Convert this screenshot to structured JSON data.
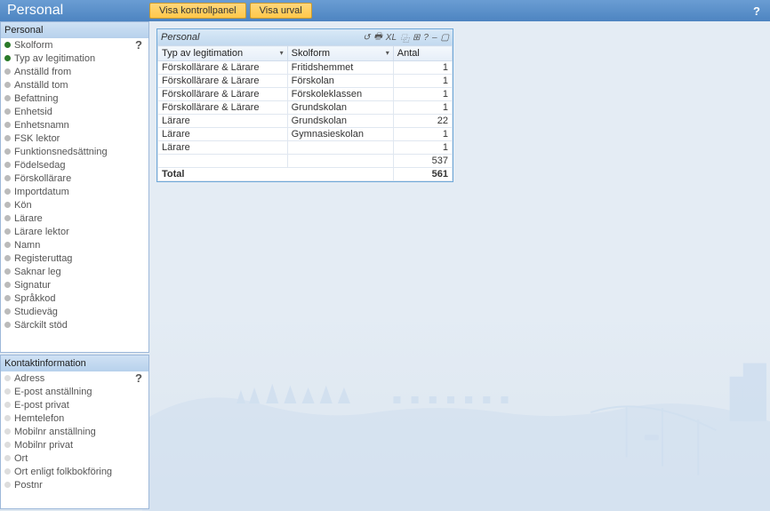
{
  "header": {
    "title": "Personal",
    "btn_panel": "Visa kontrollpanel",
    "btn_urval": "Visa urval",
    "help": "?"
  },
  "sidebar1": {
    "title": "Personal",
    "help": "?",
    "items": [
      {
        "label": "Skolform",
        "on": true
      },
      {
        "label": "Typ av legitimation",
        "on": true
      },
      {
        "label": "Anställd from",
        "on": false
      },
      {
        "label": "Anställd tom",
        "on": false
      },
      {
        "label": "Befattning",
        "on": false
      },
      {
        "label": "Enhetsid",
        "on": false
      },
      {
        "label": "Enhetsnamn",
        "on": false
      },
      {
        "label": "FSK lektor",
        "on": false
      },
      {
        "label": "Funktionsnedsättning",
        "on": false
      },
      {
        "label": "Födelsedag",
        "on": false
      },
      {
        "label": "Förskollärare",
        "on": false
      },
      {
        "label": "Importdatum",
        "on": false
      },
      {
        "label": "Kön",
        "on": false
      },
      {
        "label": "Lärare",
        "on": false
      },
      {
        "label": "Lärare lektor",
        "on": false
      },
      {
        "label": "Namn",
        "on": false
      },
      {
        "label": "Registeruttag",
        "on": false
      },
      {
        "label": "Saknar leg",
        "on": false
      },
      {
        "label": "Signatur",
        "on": false
      },
      {
        "label": "Språkkod",
        "on": false
      },
      {
        "label": "Studieväg",
        "on": false
      },
      {
        "label": "Särckilt stöd",
        "on": false
      }
    ]
  },
  "sidebar2": {
    "title": "Kontaktinformation",
    "help": "?",
    "items": [
      {
        "label": "Adress"
      },
      {
        "label": "E-post anställning"
      },
      {
        "label": "E-post privat"
      },
      {
        "label": "Hemtelefon"
      },
      {
        "label": "Mobilnr anställning"
      },
      {
        "label": "Mobilnr privat"
      },
      {
        "label": "Ort"
      },
      {
        "label": "Ort enligt folkbokföring"
      },
      {
        "label": "Postnr"
      }
    ]
  },
  "table": {
    "title": "Personal",
    "icons": [
      "↺",
      "🖶",
      "XL",
      "⿻",
      "⊞",
      "?",
      "–",
      "▢"
    ],
    "cols": [
      "Typ av legitimation",
      "Skolform",
      "Antal"
    ],
    "rows": [
      {
        "c0": "Förskollärare & Lärare",
        "c1": "Fritidshemmet",
        "c2": "1"
      },
      {
        "c0": "Förskollärare & Lärare",
        "c1": "Förskolan",
        "c2": "1"
      },
      {
        "c0": "Förskollärare & Lärare",
        "c1": "Förskoleklassen",
        "c2": "1"
      },
      {
        "c0": "Förskollärare & Lärare",
        "c1": "Grundskolan",
        "c2": "1"
      },
      {
        "c0": "Lärare",
        "c1": "Grundskolan",
        "c2": "22"
      },
      {
        "c0": "Lärare",
        "c1": "Gymnasieskolan",
        "c2": "1"
      },
      {
        "c0": "Lärare",
        "c1": "",
        "c2": "1"
      },
      {
        "c0": "",
        "c1": "",
        "c2": "537"
      }
    ],
    "total_label": "Total",
    "total_value": "561"
  }
}
